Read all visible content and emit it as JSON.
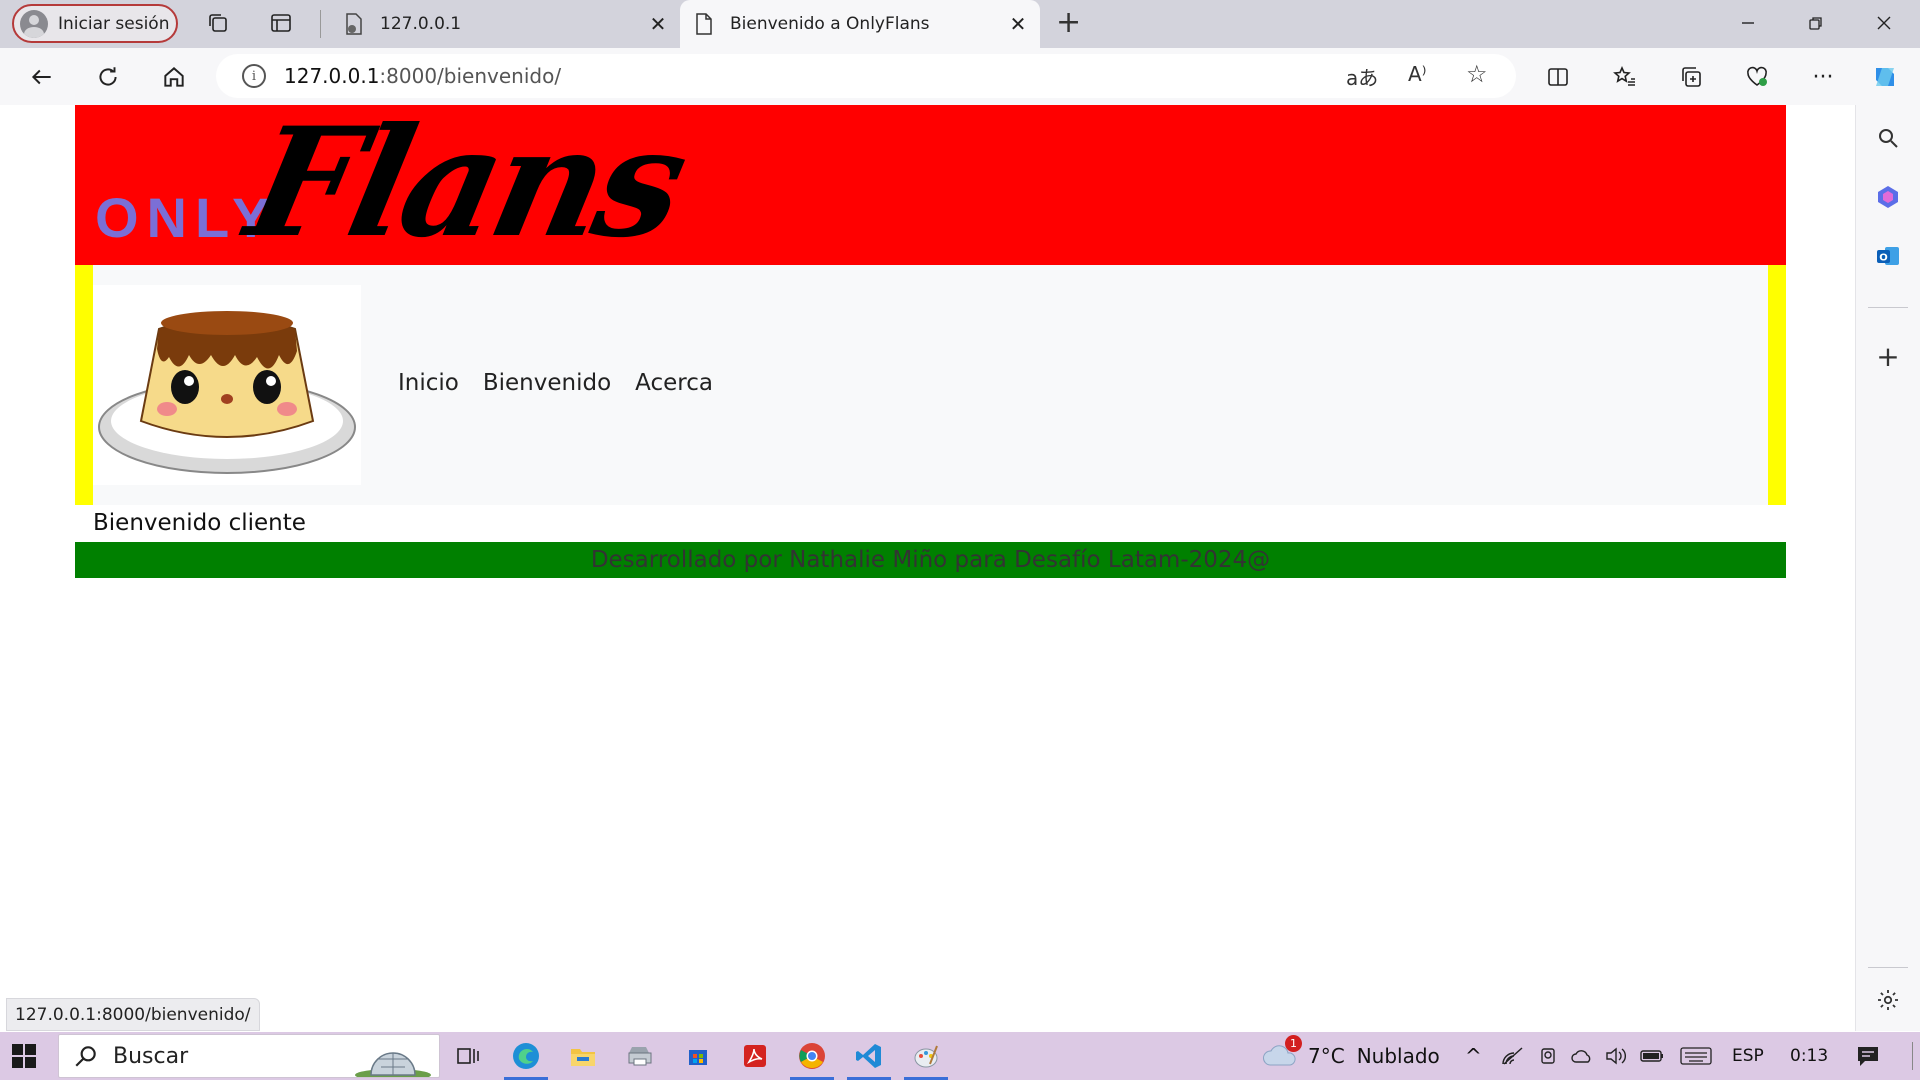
{
  "browser": {
    "profile_label": "Iniciar sesión",
    "tabs": [
      {
        "title": "127.0.0.1",
        "active": false
      },
      {
        "title": "Bienvenido a OnlyFlans",
        "active": true
      }
    ],
    "address": {
      "host": "127.0.0.1",
      "path": ":8000/bienvenido/"
    },
    "status_url": "127.0.0.1:8000/bienvenido/"
  },
  "site": {
    "logo_only": "ONLY",
    "logo_flans": "Flans",
    "nav": [
      "Inicio",
      "Bienvenido",
      "Acerca"
    ],
    "welcome": "Bienvenido cliente",
    "footer": "Desarrollado por Nathalie Miño para Desafío Latam-2024@"
  },
  "taskbar": {
    "search_label": "Buscar",
    "weather_temp": "7°C",
    "weather_desc": "Nublado",
    "weather_badge": "1",
    "language": "ESP",
    "time": "0:13"
  },
  "colors": {
    "header": "#ff0000",
    "nav_border": "#ffff00",
    "footer": "#008000",
    "logo_only": "#7b6fd6"
  }
}
